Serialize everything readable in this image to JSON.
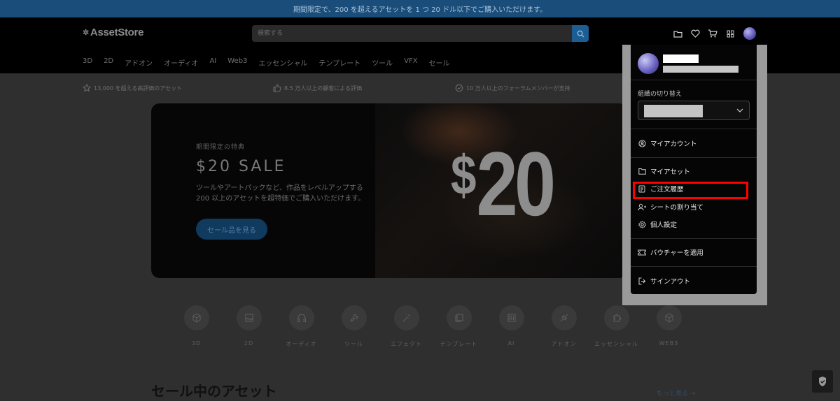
{
  "promo_banner": {
    "text": "期間限定で、200 を超えるアセットを 1 つ 20 ドル以下でご購入いただけます。"
  },
  "header": {
    "logo_text": "AssetStore",
    "search_placeholder": "検索する",
    "icons": [
      "folder-icon",
      "heart-icon",
      "cart-icon",
      "grid-icon",
      "avatar"
    ]
  },
  "category_nav": [
    "3D",
    "2D",
    "アドオン",
    "オーディオ",
    "AI",
    "Web3",
    "エッセンシャル",
    "テンプレート",
    "ツール",
    "VFX",
    "セール"
  ],
  "trust": [
    {
      "icon": "star-icon",
      "text": "13,000 を超える高評価のアセット"
    },
    {
      "icon": "thumbs-up-icon",
      "text": "8.5 万人以上の顧客による評価"
    },
    {
      "icon": "check-circle-icon",
      "text": "10 万人以上のフォーラムメンバーが支持"
    }
  ],
  "hero": {
    "eyebrow": "期間限定の特典",
    "title": "$20 SALE",
    "description": "ツールやアートパックなど、作品をレベルアップする 200 以上のアセットを超特価でご購入いただけます。",
    "cta": "セール品を見る",
    "big_dollar": "$",
    "big_number": "20"
  },
  "categories": [
    {
      "label": "3D",
      "icon": "cube-icon"
    },
    {
      "label": "2D",
      "icon": "image-icon"
    },
    {
      "label": "オーディオ",
      "icon": "headphones-icon"
    },
    {
      "label": "ツール",
      "icon": "wrench-icon"
    },
    {
      "label": "エフェクト",
      "icon": "wand-icon"
    },
    {
      "label": "テンプレート",
      "icon": "copy-icon"
    },
    {
      "label": "AI",
      "icon": "ai-icon"
    },
    {
      "label": "アドオン",
      "icon": "plug-icon"
    },
    {
      "label": "エッセンシャル",
      "icon": "puzzle-icon"
    },
    {
      "label": "WEB3",
      "icon": "cube-icon"
    }
  ],
  "sale_section": {
    "title": "セール中のアセット",
    "see_more": "もっと見る →"
  },
  "dropdown": {
    "org_label": "組織の切り替え",
    "items": [
      {
        "label": "マイアカウント",
        "icon": "user-circle-icon"
      },
      {
        "label": "マイアセット",
        "icon": "folder-icon"
      },
      {
        "label": "ご注文履歴",
        "icon": "receipt-icon"
      },
      {
        "label": "シートの割り当て",
        "icon": "user-add-icon"
      },
      {
        "label": "個人設定",
        "icon": "gear-icon"
      },
      {
        "label": "バウチャーを適用",
        "icon": "ticket-icon"
      },
      {
        "label": "サインアウト",
        "icon": "signout-icon"
      }
    ]
  },
  "colors": {
    "promo_bg": "#1a4d79",
    "highlight": "#ff0000",
    "cta_bg": "#103a5e"
  }
}
